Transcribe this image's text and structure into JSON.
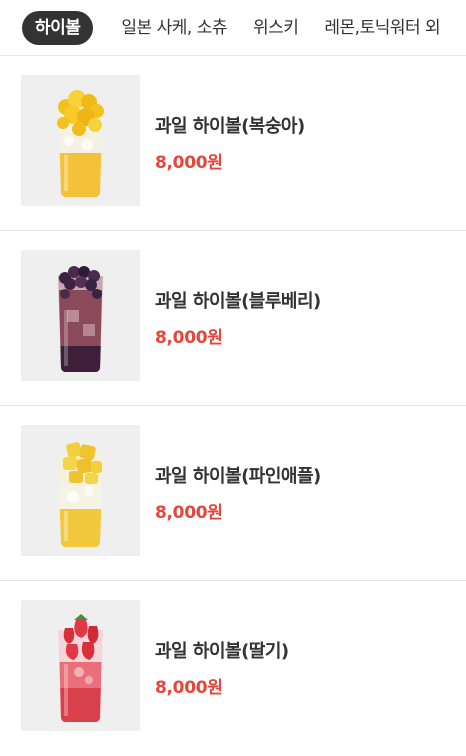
{
  "tabs": [
    {
      "label": "하이볼",
      "active": true
    },
    {
      "label": "일본 사케, 소츄",
      "active": false
    },
    {
      "label": "위스키",
      "active": false
    },
    {
      "label": "레몬,토닉워터 외",
      "active": false
    }
  ],
  "colors": {
    "active_tab_bg": "#333333",
    "price": "#e8453c",
    "thumb_bg": "#efefef"
  },
  "items": [
    {
      "name": "과일 하이볼(복숭아)",
      "price": "8,000원",
      "image": "peach-highball-photo",
      "fruit_color": "#f4c21f",
      "liquid_color": "#f3c23a"
    },
    {
      "name": "과일 하이볼(블루베리)",
      "price": "8,000원",
      "image": "blueberry-highball-photo",
      "fruit_color": "#4a2a4e",
      "liquid_color": "#8a4a5a"
    },
    {
      "name": "과일 하이볼(파인애플)",
      "price": "8,000원",
      "image": "pineapple-highball-photo",
      "fruit_color": "#f3cf3a",
      "liquid_color": "#f2c93c"
    },
    {
      "name": "과일 하이볼(딸기)",
      "price": "8,000원",
      "image": "strawberry-highball-photo",
      "fruit_color": "#d8303a",
      "liquid_color": "#e8707a"
    }
  ]
}
